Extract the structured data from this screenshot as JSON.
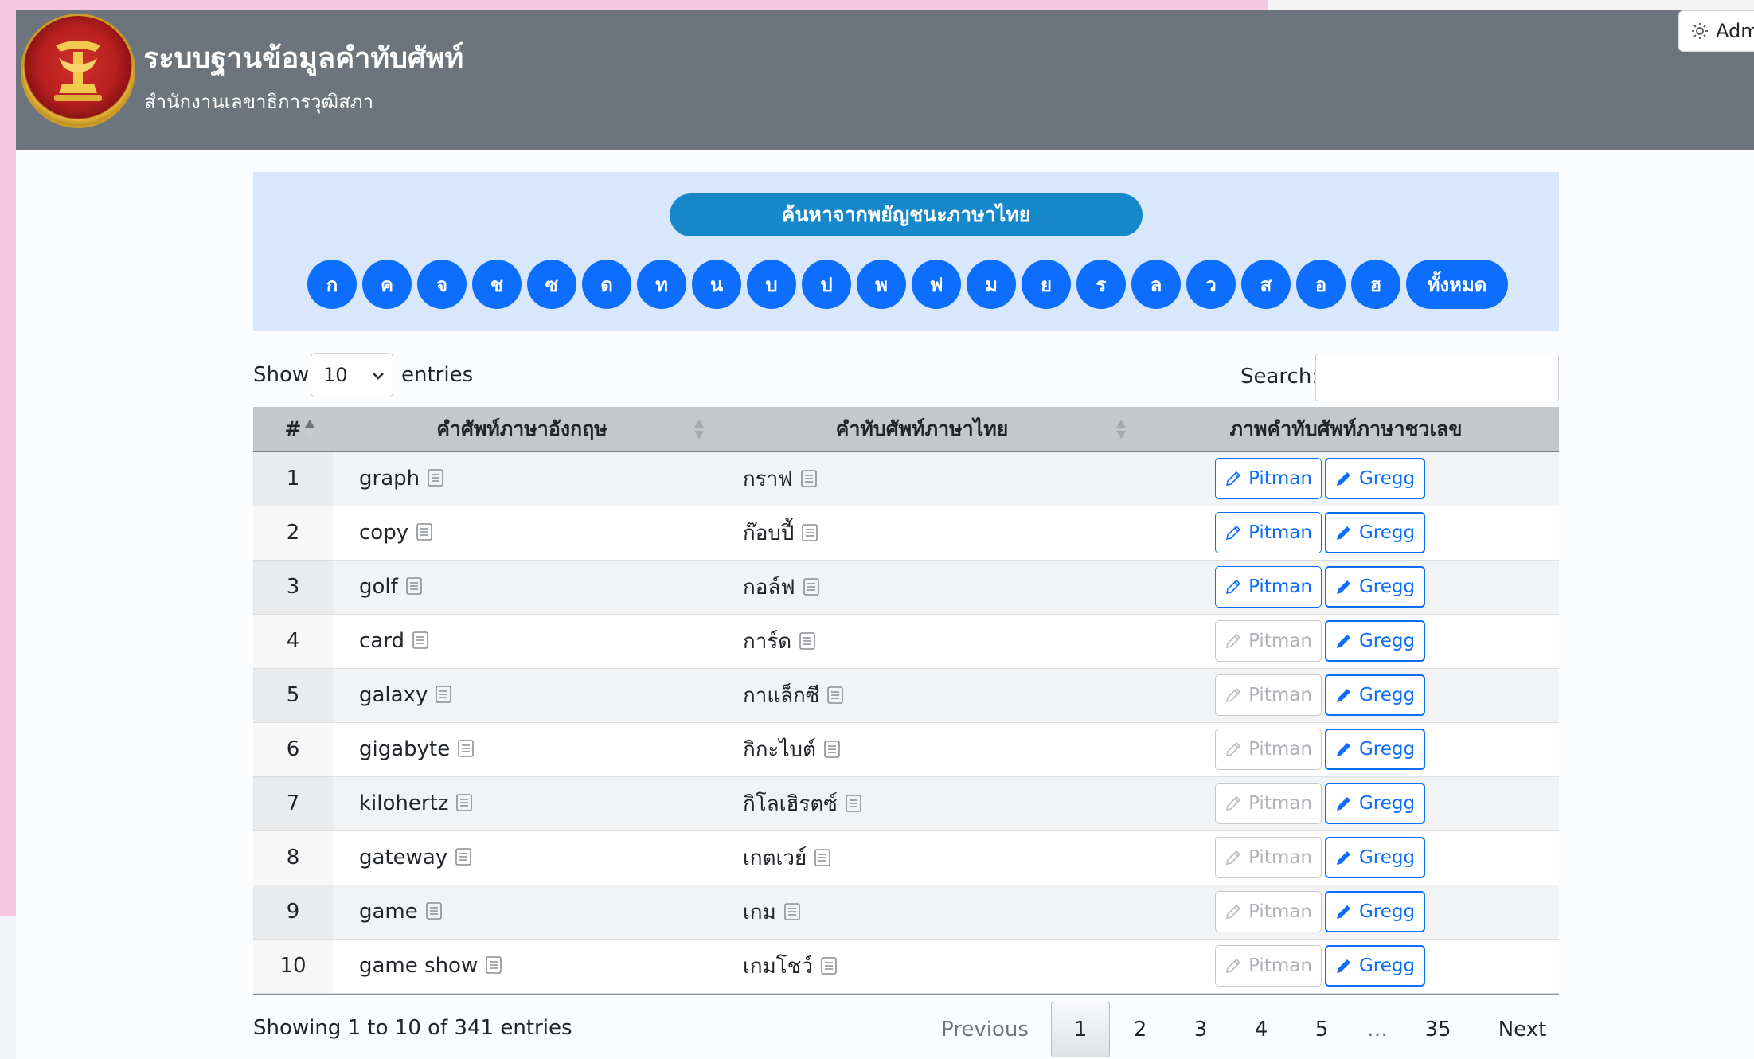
{
  "header": {
    "title": "ระบบฐานข้อมูลคำทับศัพท์",
    "subtitle": "สำนักงานเลขาธิการวุฒิสภา",
    "admin_label": "Adm"
  },
  "letters": {
    "heading": "ค้นหาจากพยัญชนะภาษาไทย",
    "items": [
      "ก",
      "ค",
      "จ",
      "ช",
      "ซ",
      "ด",
      "ท",
      "น",
      "บ",
      "ป",
      "พ",
      "ฟ",
      "ม",
      "ย",
      "ร",
      "ล",
      "ว",
      "ส",
      "อ",
      "ฮ"
    ],
    "all_label": "ทั้งหมด"
  },
  "controls": {
    "show_label": "Show",
    "show_value": "10",
    "entries_label": "entries",
    "search_label": "Search:",
    "search_value": ""
  },
  "table": {
    "columns": [
      "#",
      "คำศัพท์ภาษาอังกฤษ",
      "คำทับศัพท์ภาษาไทย",
      "ภาพคำทับศัพท์ภาษาชวเลข"
    ],
    "pitman_label": "Pitman",
    "gregg_label": "Gregg",
    "rows": [
      {
        "num": "1",
        "en": "graph",
        "th": "กราฟ",
        "pitman_enabled": true
      },
      {
        "num": "2",
        "en": "copy",
        "th": "ก๊อบปี้",
        "pitman_enabled": true
      },
      {
        "num": "3",
        "en": "golf",
        "th": "กอล์ฟ",
        "pitman_enabled": true
      },
      {
        "num": "4",
        "en": "card",
        "th": "การ์ด",
        "pitman_enabled": false
      },
      {
        "num": "5",
        "en": "galaxy",
        "th": "กาแล็กซี",
        "pitman_enabled": false
      },
      {
        "num": "6",
        "en": "gigabyte",
        "th": "กิกะไบต์",
        "pitman_enabled": false
      },
      {
        "num": "7",
        "en": "kilohertz",
        "th": "กิโลเฮิรตซ์",
        "pitman_enabled": false
      },
      {
        "num": "8",
        "en": "gateway",
        "th": "เกตเวย์",
        "pitman_enabled": false
      },
      {
        "num": "9",
        "en": "game",
        "th": "เกม",
        "pitman_enabled": false
      },
      {
        "num": "10",
        "en": "game show",
        "th": "เกมโชว์",
        "pitman_enabled": false
      }
    ]
  },
  "footer": {
    "info": "Showing 1 to 10 of 341 entries",
    "previous": "Previous",
    "pages": [
      "1",
      "2",
      "3",
      "4",
      "5"
    ],
    "current_page": "1",
    "ellipsis": "…",
    "last_page": "35",
    "next": "Next"
  },
  "colors": {
    "header_bg": "#6c757d",
    "letters_panel_bg": "#d8e7fb",
    "letter_button": "#0d6efd",
    "heading_pill": "#1687c8",
    "primary": "#0d6efd"
  }
}
